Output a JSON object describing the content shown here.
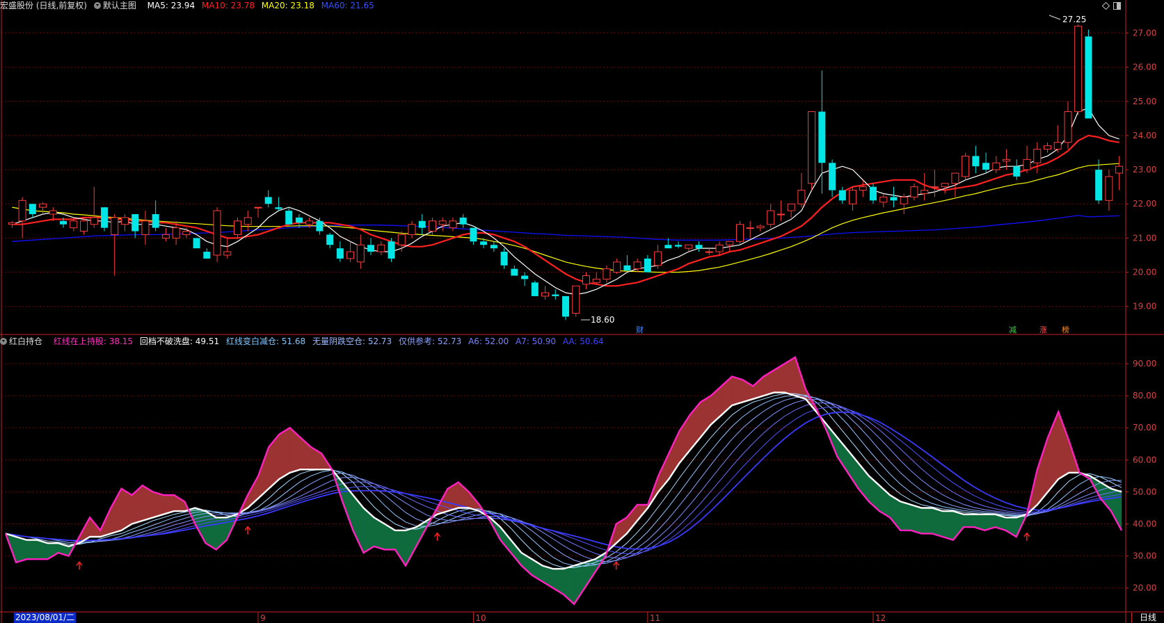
{
  "header_main": {
    "stock": "宏盛股份 (日线,前复权)",
    "template": "默认主图",
    "ma5": "MA5: 23.94",
    "ma10": "MA10: 23.78",
    "ma20": "MA20: 23.18",
    "ma60": "MA60: 21.65"
  },
  "header_ind": {
    "name": "红白持仓",
    "v1": "红线在上持股: 38.15",
    "v2": "回档不破洗盘: 49.51",
    "v3": "红线变白减仓: 51.68",
    "v4": "无量阴跌空仓: 52.73",
    "v5": "仅供参考: 52.73",
    "v6": "A6: 52.00",
    "v7": "A7: 50.90",
    "v8": "AA: 50.64"
  },
  "markers": {
    "high": "27.25",
    "low": "18.60",
    "cai": "财",
    "jian": "减",
    "zhang": "涨",
    "bang": "榜"
  },
  "footer": {
    "date": "2023/08/01/二",
    "period": "日线"
  },
  "colors": {
    "up": "#ff3b3b",
    "down": "#00e5e5",
    "ma5": "#ffffff",
    "ma10": "#ff2020",
    "ma20": "#ffff00",
    "ma60": "#1010ff",
    "grid": "#7a0000",
    "bull_fill": "#9b3333",
    "bear_fill": "#0f6a3c"
  },
  "chart_data": [
    {
      "type": "candlestick",
      "y_ticks": [
        "19.00",
        "20.00",
        "21.00",
        "22.00",
        "23.00",
        "24.00",
        "25.00",
        "26.00",
        "27.00"
      ],
      "ylim": [
        18.2,
        27.6
      ],
      "x_ticks": [
        "9",
        "10",
        "11",
        "12"
      ],
      "x_tick_index": [
        24,
        45,
        62,
        84
      ],
      "ohlc": [
        [
          21.4,
          21.5,
          21.3,
          21.45
        ],
        [
          21.5,
          22.2,
          21.0,
          22.1
        ],
        [
          22.0,
          22.0,
          21.6,
          21.7
        ],
        [
          21.9,
          22.05,
          21.7,
          22.0
        ],
        [
          21.7,
          21.9,
          21.5,
          21.8
        ],
        [
          21.5,
          21.6,
          21.3,
          21.4
        ],
        [
          21.3,
          21.6,
          21.2,
          21.5
        ],
        [
          21.2,
          21.6,
          21.1,
          21.5
        ],
        [
          21.4,
          22.5,
          21.3,
          21.6
        ],
        [
          21.9,
          21.9,
          21.2,
          21.3
        ],
        [
          21.1,
          21.7,
          19.9,
          21.6
        ],
        [
          21.4,
          21.7,
          21.2,
          21.6
        ],
        [
          21.7,
          21.7,
          21.0,
          21.2
        ],
        [
          21.1,
          21.8,
          20.8,
          21.5
        ],
        [
          21.7,
          22.1,
          21.2,
          21.3
        ],
        [
          21.0,
          21.3,
          20.9,
          21.1
        ],
        [
          21.0,
          21.5,
          20.8,
          21.3
        ],
        [
          21.1,
          21.3,
          21.0,
          21.2
        ],
        [
          21.0,
          21.0,
          20.7,
          20.7
        ],
        [
          20.6,
          20.7,
          20.4,
          20.4
        ],
        [
          20.5,
          21.9,
          20.3,
          21.8
        ],
        [
          20.5,
          21.0,
          20.4,
          20.6
        ],
        [
          21.1,
          21.6,
          21.0,
          21.5
        ],
        [
          21.4,
          21.8,
          21.2,
          21.6
        ],
        [
          21.9,
          21.9,
          21.6,
          21.9
        ],
        [
          22.2,
          22.4,
          21.9,
          22.0
        ],
        [
          21.9,
          22.2,
          21.8,
          21.85
        ],
        [
          21.8,
          21.9,
          21.4,
          21.4
        ],
        [
          21.6,
          21.7,
          21.3,
          21.45
        ],
        [
          21.4,
          21.6,
          21.3,
          21.5
        ],
        [
          21.5,
          21.6,
          21.1,
          21.2
        ],
        [
          21.1,
          21.15,
          20.7,
          20.8
        ],
        [
          20.7,
          20.9,
          20.3,
          20.4
        ],
        [
          20.4,
          20.9,
          20.3,
          20.6
        ],
        [
          20.3,
          21.1,
          20.1,
          20.8
        ],
        [
          20.8,
          21.0,
          20.5,
          20.6
        ],
        [
          20.6,
          20.9,
          20.5,
          20.8
        ],
        [
          20.9,
          21.0,
          20.3,
          20.4
        ],
        [
          20.8,
          21.2,
          20.6,
          21.1
        ],
        [
          21.1,
          21.5,
          21.0,
          21.4
        ],
        [
          21.5,
          21.7,
          21.1,
          21.3
        ],
        [
          21.2,
          21.6,
          21.1,
          21.5
        ],
        [
          21.4,
          21.6,
          21.2,
          21.5
        ],
        [
          21.3,
          21.6,
          21.2,
          21.5
        ],
        [
          21.6,
          21.7,
          21.3,
          21.4
        ],
        [
          21.3,
          21.3,
          20.8,
          20.9
        ],
        [
          20.9,
          21.0,
          20.7,
          20.8
        ],
        [
          20.8,
          20.9,
          20.6,
          20.7
        ],
        [
          20.6,
          20.7,
          20.1,
          20.2
        ],
        [
          20.1,
          20.2,
          19.9,
          19.9
        ],
        [
          19.9,
          20.0,
          19.6,
          19.8
        ],
        [
          19.7,
          19.75,
          19.3,
          19.3
        ],
        [
          19.3,
          19.6,
          19.2,
          19.4
        ],
        [
          19.35,
          19.5,
          19.2,
          19.3
        ],
        [
          19.3,
          19.3,
          18.6,
          18.7
        ],
        [
          18.8,
          19.6,
          18.7,
          19.6
        ],
        [
          19.65,
          20.0,
          19.5,
          19.9
        ],
        [
          19.7,
          20.0,
          19.65,
          19.8
        ],
        [
          19.8,
          20.2,
          19.7,
          20.1
        ],
        [
          20.0,
          20.4,
          19.95,
          20.3
        ],
        [
          20.2,
          20.5,
          20.0,
          20.05
        ],
        [
          20.1,
          20.4,
          20.0,
          20.3
        ],
        [
          20.4,
          20.5,
          20.0,
          20.0
        ],
        [
          20.2,
          20.8,
          20.1,
          20.6
        ],
        [
          20.8,
          21.0,
          20.7,
          20.7
        ],
        [
          20.8,
          20.9,
          20.7,
          20.75
        ],
        [
          20.7,
          20.8,
          20.6,
          20.8
        ],
        [
          20.8,
          20.9,
          20.6,
          20.7
        ],
        [
          20.6,
          20.7,
          20.5,
          20.6
        ],
        [
          20.6,
          20.9,
          20.5,
          20.8
        ],
        [
          20.8,
          20.9,
          20.6,
          20.9
        ],
        [
          20.9,
          21.5,
          20.8,
          21.4
        ],
        [
          21.3,
          21.5,
          21.0,
          21.3
        ],
        [
          21.3,
          21.4,
          21.2,
          21.35
        ],
        [
          21.4,
          22.0,
          21.3,
          21.8
        ],
        [
          21.7,
          22.1,
          21.5,
          21.7
        ],
        [
          21.8,
          22.0,
          21.6,
          22.0
        ],
        [
          22.0,
          22.9,
          21.9,
          22.4
        ],
        [
          22.6,
          24.7,
          22.4,
          24.7
        ],
        [
          24.7,
          25.9,
          22.3,
          23.2
        ],
        [
          23.2,
          23.3,
          22.2,
          22.4
        ],
        [
          22.4,
          22.5,
          22.0,
          22.1
        ],
        [
          22.0,
          22.5,
          21.8,
          22.4
        ],
        [
          22.4,
          22.7,
          22.2,
          22.5
        ],
        [
          22.5,
          22.6,
          22.0,
          22.1
        ],
        [
          22.05,
          22.3,
          21.9,
          22.2
        ],
        [
          22.2,
          22.5,
          21.9,
          22.1
        ],
        [
          22.0,
          22.3,
          21.7,
          22.2
        ],
        [
          22.2,
          22.6,
          22.1,
          22.5
        ],
        [
          22.3,
          22.9,
          22.1,
          22.4
        ],
        [
          22.5,
          23.0,
          22.2,
          22.5
        ],
        [
          22.5,
          22.6,
          22.3,
          22.6
        ],
        [
          22.6,
          22.9,
          22.2,
          22.9
        ],
        [
          22.8,
          23.5,
          22.7,
          23.4
        ],
        [
          23.4,
          23.7,
          22.9,
          23.1
        ],
        [
          23.2,
          23.5,
          22.9,
          23.0
        ],
        [
          23.0,
          23.4,
          22.9,
          23.2
        ],
        [
          23.25,
          23.6,
          23.0,
          23.3
        ],
        [
          23.1,
          23.3,
          22.7,
          22.8
        ],
        [
          23.0,
          23.7,
          22.9,
          23.3
        ],
        [
          23.2,
          23.8,
          22.9,
          23.6
        ],
        [
          23.6,
          23.8,
          23.5,
          23.7
        ],
        [
          23.6,
          24.3,
          23.5,
          23.8
        ],
        [
          23.8,
          25.0,
          23.6,
          24.7
        ],
        [
          24.7,
          27.25,
          24.6,
          27.2
        ],
        [
          26.9,
          27.1,
          24.5,
          24.5
        ],
        [
          23.0,
          23.3,
          22.0,
          22.1
        ],
        [
          22.1,
          23.0,
          21.8,
          22.8
        ],
        [
          22.9,
          23.4,
          22.4,
          23.1
        ]
      ],
      "ma5": [
        21.4,
        21.5,
        21.6,
        21.7,
        21.75,
        21.7,
        21.6,
        21.55,
        21.5,
        21.5,
        21.45,
        21.5,
        21.4,
        21.4,
        21.4,
        21.35,
        21.3,
        21.25,
        21.1,
        20.9,
        20.8,
        20.75,
        20.9,
        21.1,
        21.3,
        21.6,
        21.8,
        21.9,
        21.8,
        21.65,
        21.5,
        21.3,
        21.05,
        20.9,
        20.75,
        20.65,
        20.6,
        20.6,
        20.7,
        20.85,
        21.05,
        21.2,
        21.35,
        21.4,
        21.45,
        21.35,
        21.2,
        21.0,
        20.75,
        20.45,
        20.2,
        19.95,
        19.75,
        19.55,
        19.4,
        19.35,
        19.4,
        19.5,
        19.65,
        19.8,
        20.0,
        20.1,
        20.15,
        20.2,
        20.35,
        20.45,
        20.6,
        20.7,
        20.7,
        20.7,
        20.75,
        20.8,
        20.95,
        21.1,
        21.25,
        21.4,
        21.55,
        21.8,
        22.4,
        22.9,
        23.0,
        23.1,
        23.0,
        22.7,
        22.4,
        22.3,
        22.25,
        22.2,
        22.25,
        22.3,
        22.35,
        22.45,
        22.55,
        22.7,
        22.8,
        22.9,
        23.05,
        23.1,
        23.1,
        23.15,
        23.3,
        23.4,
        23.6,
        24.0,
        24.7,
        24.8,
        24.3,
        24.0,
        23.9
      ],
      "ma10": [
        21.4,
        21.4,
        21.45,
        21.5,
        21.55,
        21.55,
        21.55,
        21.6,
        21.6,
        21.6,
        21.55,
        21.55,
        21.5,
        21.5,
        21.45,
        21.45,
        21.4,
        21.35,
        21.3,
        21.2,
        21.1,
        21.0,
        21.0,
        21.05,
        21.1,
        21.2,
        21.3,
        21.4,
        21.45,
        21.45,
        21.45,
        21.45,
        21.4,
        21.35,
        21.25,
        21.1,
        21.0,
        20.9,
        20.8,
        20.75,
        20.75,
        20.8,
        20.9,
        21.0,
        21.1,
        21.15,
        21.15,
        21.1,
        21.0,
        20.9,
        20.75,
        20.55,
        20.35,
        20.15,
        19.95,
        19.8,
        19.7,
        19.65,
        19.6,
        19.6,
        19.65,
        19.7,
        19.8,
        19.9,
        20.0,
        20.1,
        20.25,
        20.35,
        20.45,
        20.5,
        20.6,
        20.65,
        20.75,
        20.85,
        20.95,
        21.05,
        21.2,
        21.35,
        21.6,
        21.9,
        22.15,
        22.35,
        22.5,
        22.55,
        22.6,
        22.65,
        22.7,
        22.7,
        22.7,
        22.55,
        22.45,
        22.4,
        22.45,
        22.5,
        22.55,
        22.65,
        22.75,
        22.85,
        22.9,
        23.0,
        23.1,
        23.2,
        23.35,
        23.55,
        23.85,
        24.0,
        23.95,
        23.85,
        23.8
      ],
      "ma20": [
        21.9,
        21.85,
        21.8,
        21.78,
        21.76,
        21.74,
        21.7,
        21.68,
        21.65,
        21.62,
        21.6,
        21.57,
        21.55,
        21.52,
        21.5,
        21.48,
        21.46,
        21.44,
        21.42,
        21.4,
        21.38,
        21.36,
        21.35,
        21.34,
        21.34,
        21.34,
        21.34,
        21.35,
        21.36,
        21.36,
        21.36,
        21.35,
        21.33,
        21.3,
        21.27,
        21.23,
        21.2,
        21.17,
        21.14,
        21.12,
        21.1,
        21.08,
        21.06,
        21.04,
        21.02,
        21.0,
        20.96,
        20.9,
        20.85,
        20.78,
        20.7,
        20.6,
        20.5,
        20.4,
        20.3,
        20.23,
        20.17,
        20.12,
        20.08,
        20.05,
        20.03,
        20.02,
        20.01,
        20.0,
        20.0,
        20.0,
        20.02,
        20.05,
        20.1,
        20.15,
        20.22,
        20.3,
        20.38,
        20.46,
        20.55,
        20.65,
        20.75,
        20.87,
        21.0,
        21.15,
        21.3,
        21.42,
        21.52,
        21.6,
        21.67,
        21.74,
        21.8,
        21.86,
        21.92,
        21.98,
        22.04,
        22.1,
        22.17,
        22.24,
        22.3,
        22.38,
        22.45,
        22.52,
        22.58,
        22.62,
        22.7,
        22.78,
        22.85,
        22.95,
        23.05,
        23.12,
        23.14,
        23.16,
        23.18
      ],
      "ma60": [
        20.9,
        20.92,
        20.94,
        20.96,
        20.98,
        21.0,
        21.02,
        21.04,
        21.06,
        21.07,
        21.08,
        21.09,
        21.1,
        21.1,
        21.1,
        21.11,
        21.12,
        21.13,
        21.14,
        21.15,
        21.16,
        21.18,
        21.2,
        21.22,
        21.24,
        21.26,
        21.28,
        21.3,
        21.32,
        21.34,
        21.35,
        21.36,
        21.37,
        21.38,
        21.38,
        21.38,
        21.38,
        21.37,
        21.36,
        21.35,
        21.34,
        21.33,
        21.31,
        21.29,
        21.27,
        21.25,
        21.23,
        21.21,
        21.19,
        21.17,
        21.15,
        21.13,
        21.12,
        21.1,
        21.08,
        21.07,
        21.06,
        21.05,
        21.04,
        21.03,
        21.02,
        21.0,
        20.98,
        20.96,
        20.95,
        20.94,
        20.94,
        20.94,
        20.94,
        20.94,
        20.95,
        20.96,
        20.97,
        20.98,
        20.99,
        21.0,
        21.02,
        21.04,
        21.06,
        21.09,
        21.12,
        21.14,
        21.16,
        21.17,
        21.18,
        21.19,
        21.2,
        21.21,
        21.22,
        21.23,
        21.24,
        21.26,
        21.28,
        21.3,
        21.32,
        21.35,
        21.38,
        21.41,
        21.44,
        21.47,
        21.5,
        21.54,
        21.58,
        21.62,
        21.66,
        21.62,
        21.63,
        21.64,
        21.65
      ]
    },
    {
      "type": "area",
      "name": "红白持仓",
      "y_ticks": [
        "20.00",
        "30.00",
        "40.00",
        "50.00",
        "60.00",
        "70.00",
        "80.00",
        "90.00"
      ],
      "ylim": [
        13,
        95
      ],
      "main": [
        37,
        28,
        29,
        29,
        29,
        31,
        30,
        36,
        42,
        38,
        45,
        51,
        49,
        52,
        50,
        49,
        49,
        47,
        40,
        34,
        32,
        35,
        42,
        49,
        55,
        64,
        68,
        70,
        67,
        64,
        62,
        57,
        47,
        38,
        31,
        33,
        32,
        32,
        27,
        33,
        39,
        45,
        51,
        53,
        50,
        46,
        41,
        35,
        31,
        27,
        24,
        22,
        20,
        18,
        15,
        20,
        25,
        30,
        40,
        42,
        46,
        46,
        55,
        62,
        69,
        74,
        78,
        80,
        83,
        86,
        85,
        83,
        86,
        88,
        90,
        92,
        82,
        76,
        69,
        61,
        56,
        51,
        47,
        44,
        42,
        38,
        38,
        37,
        37,
        36,
        35,
        39,
        39,
        38,
        39,
        38,
        36,
        43,
        57,
        67,
        75,
        66,
        56,
        54,
        48,
        44,
        38
      ],
      "white": [
        37,
        36,
        35,
        35,
        34,
        34,
        33,
        34,
        36,
        36,
        37,
        38,
        40,
        41,
        42,
        43,
        44,
        44,
        45,
        44,
        42,
        42,
        43,
        45,
        48,
        51,
        54,
        56,
        57,
        57,
        57,
        57,
        53,
        49,
        45,
        42,
        40,
        38,
        38,
        39,
        41,
        43,
        44,
        45,
        45,
        44,
        42,
        39,
        35,
        31,
        29,
        27,
        26,
        26,
        27,
        28,
        29,
        31,
        34,
        37,
        41,
        45,
        50,
        54,
        59,
        63,
        67,
        71,
        74,
        77,
        78,
        79,
        80,
        81,
        81,
        80,
        79,
        75,
        71,
        67,
        63,
        59,
        55,
        52,
        49,
        47,
        46,
        45,
        45,
        44,
        44,
        43,
        43,
        43,
        43,
        42,
        42,
        43,
        46,
        50,
        54,
        56,
        56,
        55,
        53,
        51,
        50
      ]
    }
  ]
}
